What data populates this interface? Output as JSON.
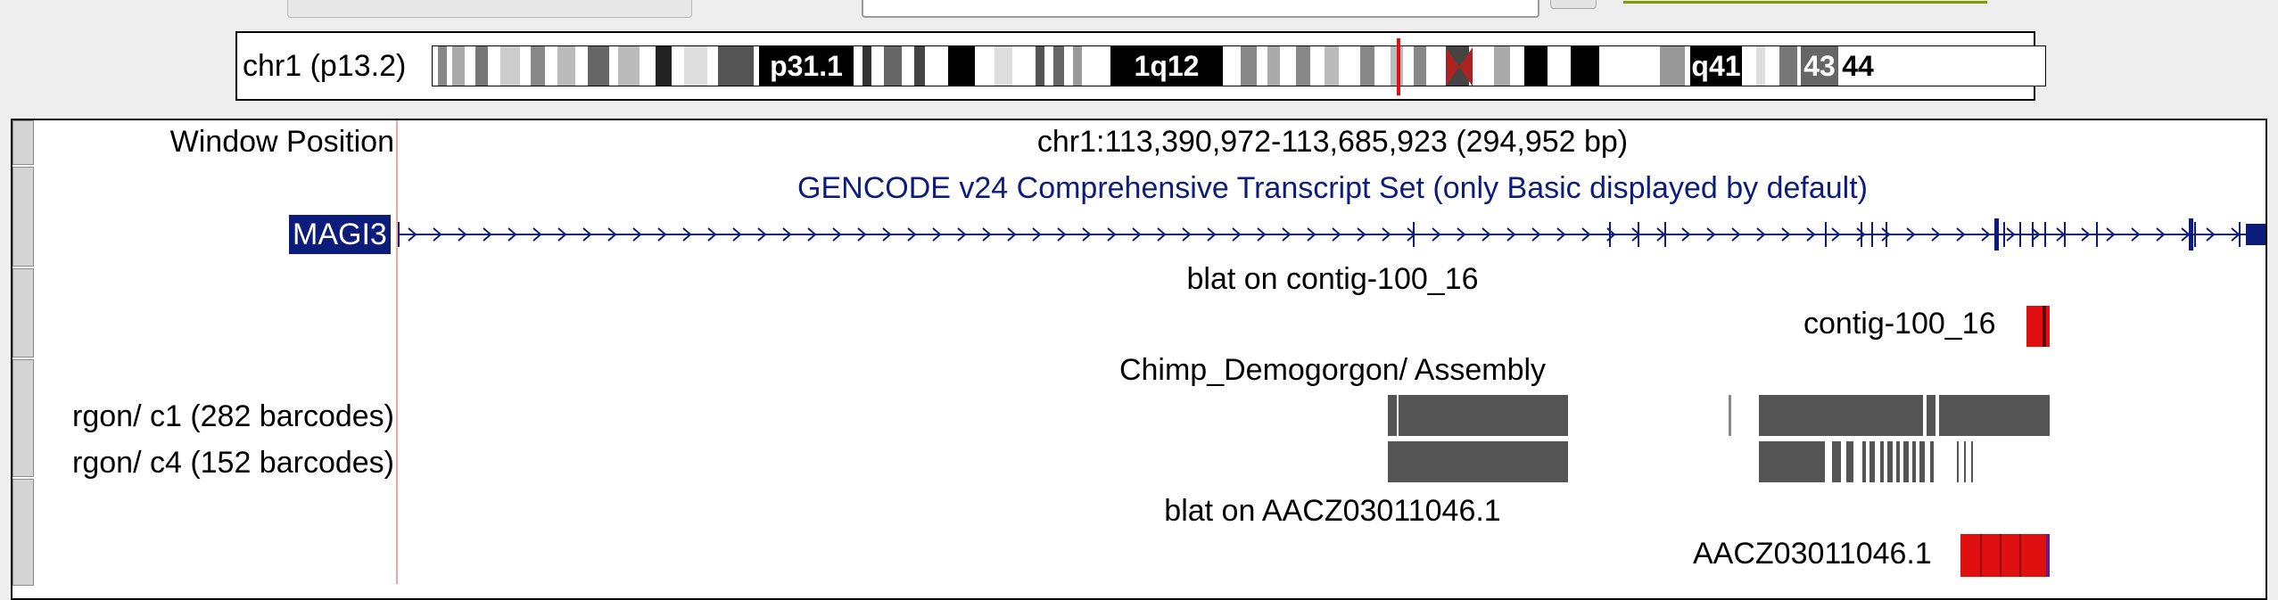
{
  "ideogram": {
    "label": "chr1 (p13.2)",
    "bands": [
      "p31.1",
      "1q12",
      "q41",
      "43",
      "44"
    ]
  },
  "browser": {
    "window_position_label": "Window Position",
    "window_position_value": "chr1:113,390,972-113,685,923 (294,952 bp)",
    "gencode_title": "GENCODE v24 Comprehensive Transcript Set (only Basic displayed by default)",
    "gene_name": "MAGI3",
    "blat1_title": "blat on contig-100_16",
    "blat1_item": "contig-100_16",
    "assembly_title": "Chimp_Demogorgon/ Assembly",
    "track_c1_label": "rgon/ c1 (282 barcodes)",
    "track_c4_label": "rgon/ c4 (152 barcodes)",
    "blat2_title": "blat on AACZ03011046.1",
    "blat2_item": "AACZ03011046.1"
  },
  "colors": {
    "gene_blue": "#0c1c7a",
    "blat_red": "#e01010",
    "assembly_gray": "#555555",
    "ideogram_marker": "#e01010"
  }
}
